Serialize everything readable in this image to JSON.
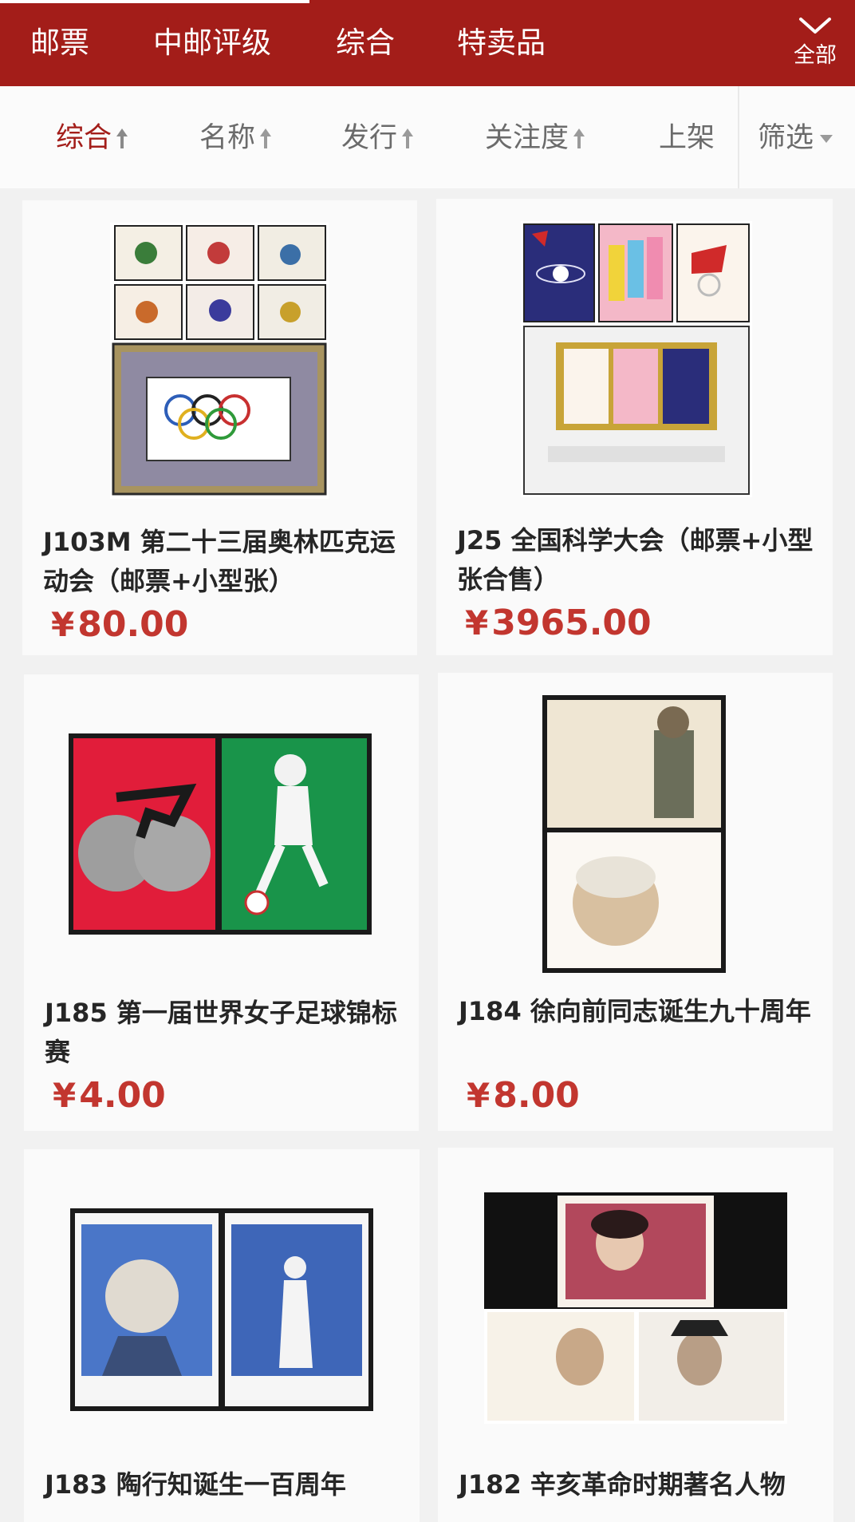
{
  "nav": {
    "categories": [
      "邮票",
      "中邮评级",
      "综合",
      "特卖品"
    ],
    "all_label": "全部"
  },
  "sort": {
    "items": [
      "综合",
      "名称",
      "发行",
      "关注度",
      "上架"
    ],
    "filter_label": "筛选"
  },
  "colors": {
    "brand": "#a31d19",
    "price": "#c2362f",
    "active_sort": "#a31d19"
  },
  "currency_symbol": "¥",
  "products": [
    {
      "title": "J103M 第二十三届奥林匹克运动会（邮票+小型张）",
      "price": "80.00",
      "image": "olympics-stamp-set-icon"
    },
    {
      "title": "J25 全国科学大会（邮票+小型张合售）",
      "price": "3965.00",
      "image": "science-conference-stamp-set-icon"
    },
    {
      "title": "J185 第一届世界女子足球锦标赛",
      "price": "4.00",
      "image": "womens-football-stamps-icon"
    },
    {
      "title": "J184 徐向前同志诞生九十周年",
      "price": "8.00",
      "image": "xu-xiangqian-stamps-icon"
    },
    {
      "title": "J183 陶行知诞生一百周年",
      "price": "",
      "image": "tao-xingzhi-stamps-icon"
    },
    {
      "title": "J182 辛亥革命时期著名人物",
      "price": "",
      "image": "xinhai-figures-stamps-icon"
    }
  ]
}
